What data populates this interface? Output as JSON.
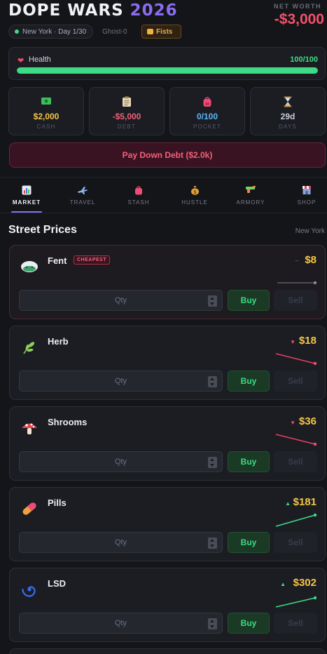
{
  "header": {
    "title_main": "DOPE WARS",
    "title_year": "2026",
    "net_worth_label": "NET WORTH",
    "net_worth_value": "-$3,000",
    "location_chip": "New York · Day 1/30",
    "player_name": "Ghost-0",
    "weapon": "Fists"
  },
  "health": {
    "label": "Health",
    "value": "100/100",
    "fraction": 1.0
  },
  "stats": [
    {
      "value": "$2,000",
      "label": "CASH",
      "icon": "cash-icon",
      "color": "#f5c542"
    },
    {
      "value": "-$5,000",
      "label": "DEBT",
      "icon": "clipboard-icon",
      "color": "#f2607a"
    },
    {
      "value": "0/100",
      "label": "POCKET",
      "icon": "backpack-icon",
      "color": "#5ab8f5"
    },
    {
      "value": "29d",
      "label": "DAYS",
      "icon": "hourglass-icon",
      "color": "#c9ccd6"
    }
  ],
  "debt_button": "Pay Down Debt ($2.0k)",
  "tabs": [
    {
      "label": "MARKET",
      "icon": "chart-icon",
      "active": true
    },
    {
      "label": "TRAVEL",
      "icon": "plane-icon",
      "active": false
    },
    {
      "label": "STASH",
      "icon": "bag-icon",
      "active": false
    },
    {
      "label": "HUSTLE",
      "icon": "money-bag-icon",
      "active": false
    },
    {
      "label": "ARMORY",
      "icon": "gun-icon",
      "active": false
    },
    {
      "label": "SHOP",
      "icon": "store-icon",
      "active": false
    }
  ],
  "market": {
    "title": "Street Prices",
    "location": "New York",
    "qty_placeholder": "Qty",
    "buy_label": "Buy",
    "sell_label": "Sell",
    "drugs": [
      {
        "name": "Fent",
        "icon": "cloud-icon",
        "price": "$8",
        "trend": "flat",
        "badge": "CHEAPEST"
      },
      {
        "name": "Herb",
        "icon": "leaf-icon",
        "price": "$18",
        "trend": "down"
      },
      {
        "name": "Shrooms",
        "icon": "mushroom-icon",
        "price": "$36",
        "trend": "down"
      },
      {
        "name": "Pills",
        "icon": "pill-icon",
        "price": "$181",
        "trend": "up"
      },
      {
        "name": "LSD",
        "icon": "spiral-icon",
        "price": "$302",
        "trend": "up"
      }
    ]
  }
}
